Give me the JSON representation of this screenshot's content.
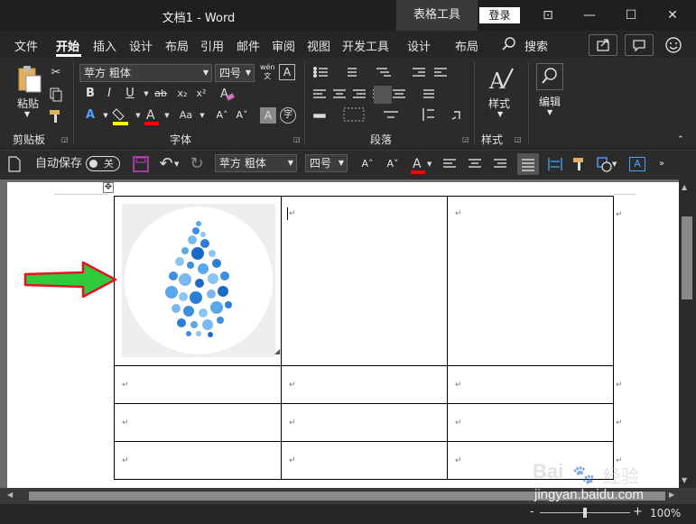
{
  "window": {
    "title": "文档1 - Word",
    "table_tools": "表格工具",
    "login": "登录",
    "minimize": "—",
    "maximize": "☐",
    "close": "✕",
    "restore_ribbon": "⊡"
  },
  "tabs": [
    {
      "label": "文件"
    },
    {
      "label": "开始"
    },
    {
      "label": "插入"
    },
    {
      "label": "设计"
    },
    {
      "label": "布局"
    },
    {
      "label": "引用"
    },
    {
      "label": "邮件"
    },
    {
      "label": "审阅"
    },
    {
      "label": "视图"
    },
    {
      "label": "开发工具"
    },
    {
      "label": "设计"
    },
    {
      "label": "布局"
    },
    {
      "label": "搜索"
    }
  ],
  "ribbon": {
    "clipboard": {
      "label": "剪贴板",
      "paste": "粘贴"
    },
    "font": {
      "label": "字体",
      "font_name": "苹方 粗体",
      "font_size": "四号",
      "wen": "wén",
      "wen_char": "文"
    },
    "paragraph": {
      "label": "段落"
    },
    "styles": {
      "label": "样式",
      "styles_btn": "样式"
    },
    "editing": {
      "label": "编辑",
      "editing_btn": "编辑"
    }
  },
  "qat": {
    "autosave": "自动保存",
    "autosave_state": "关",
    "font_name": "苹方 粗体",
    "font_size": "四号"
  },
  "table": {
    "cell_mark": "↵",
    "end_mark": "↵"
  },
  "status": {
    "zoom": "100%",
    "minus": "-",
    "plus": "+"
  },
  "watermark": {
    "brand": "Bai",
    "brand2": "经验",
    "url": "jingyan.baidu.com"
  },
  "colors": {
    "accent_red": "#e81123",
    "highlight_yellow": "#ffff00",
    "font_red": "#ff0000",
    "drop_blue": "#2c7fd6",
    "arrow_green": "#2ecc3a"
  }
}
